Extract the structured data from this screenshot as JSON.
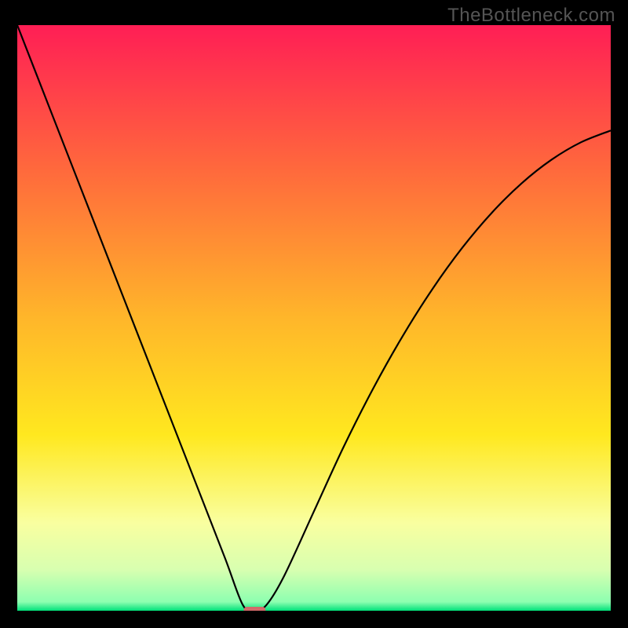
{
  "watermark": "TheBottleneck.com",
  "chart_data": {
    "type": "line",
    "title": "",
    "xlabel": "",
    "ylabel": "",
    "xlim": [
      0,
      100
    ],
    "ylim": [
      0,
      100
    ],
    "grid": false,
    "legend": false,
    "series": [
      {
        "name": "curve",
        "x": [
          0,
          5,
          10,
          15,
          20,
          25,
          30,
          35,
          38,
          40,
          42,
          45,
          50,
          55,
          60,
          65,
          70,
          75,
          80,
          85,
          90,
          95,
          100
        ],
        "y": [
          100,
          87,
          74,
          61,
          48,
          35,
          22,
          9,
          1,
          0,
          1,
          6,
          17,
          28,
          38,
          47,
          55,
          62,
          68,
          73,
          77,
          80,
          82
        ]
      }
    ],
    "marker": {
      "x": 40,
      "y": 0,
      "color": "#d26a6a"
    },
    "background_gradient": {
      "stops": [
        {
          "offset": 0.0,
          "color": "#ff1e55"
        },
        {
          "offset": 0.25,
          "color": "#ff6a3c"
        },
        {
          "offset": 0.5,
          "color": "#ffb62a"
        },
        {
          "offset": 0.7,
          "color": "#ffe81f"
        },
        {
          "offset": 0.85,
          "color": "#f9ffa0"
        },
        {
          "offset": 0.93,
          "color": "#d8ffb0"
        },
        {
          "offset": 0.985,
          "color": "#8dffb0"
        },
        {
          "offset": 1.0,
          "color": "#00e07a"
        }
      ]
    }
  }
}
